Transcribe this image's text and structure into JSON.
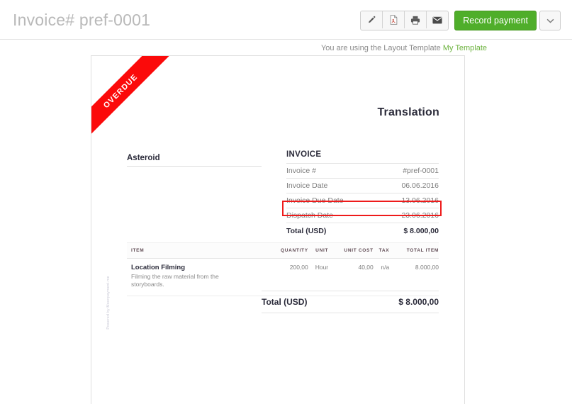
{
  "header": {
    "title": "Invoice# pref-0001",
    "toolbar": {
      "icons": [
        {
          "name": "edit-icon",
          "label": "Edit"
        },
        {
          "name": "pdf-icon",
          "label": "PDF"
        },
        {
          "name": "print-icon",
          "label": "Print"
        },
        {
          "name": "email-icon",
          "label": "Email"
        }
      ],
      "record_payment_label": "Record payment",
      "dropdown_icon": "chevron-down-icon"
    }
  },
  "template_notice": {
    "text": "You are using the Layout Template",
    "link_label": "My Template",
    "link_color": "#6db33f"
  },
  "document": {
    "ribbon": {
      "label": "OVERDUE",
      "color": "#fb0a0a"
    },
    "title": "Translation",
    "powered_by": "Powered by Moonpayment.me",
    "bill_to": {
      "name": "Asteroid"
    },
    "invoice_meta": {
      "heading": "INVOICE",
      "rows": [
        {
          "label": "Invoice #",
          "value": "#pref-0001"
        },
        {
          "label": "Invoice Date",
          "value": "06.06.2016"
        },
        {
          "label": "Invoice Due Date",
          "value": "13.06.2016"
        },
        {
          "label": "Dispatch Date",
          "value": "23.06.2016"
        }
      ],
      "total_label": "Total (USD)",
      "total_value": "$ 8.000,00",
      "highlight_color": "#ee1b1b"
    },
    "items": {
      "columns": [
        "ITEM",
        "QUANTITY",
        "UNIT",
        "UNIT COST",
        "TAX",
        "TOTAL ITEM"
      ],
      "rows": [
        {
          "name": "Location Filming",
          "description": "Filming the raw material from the storyboards.",
          "quantity": "200,00",
          "unit": "Hour",
          "unit_cost": "40,00",
          "tax": "n/a",
          "total_item": "8.000,00"
        }
      ]
    },
    "grand_total": {
      "label": "Total (USD)",
      "value": "$ 8.000,00"
    }
  }
}
